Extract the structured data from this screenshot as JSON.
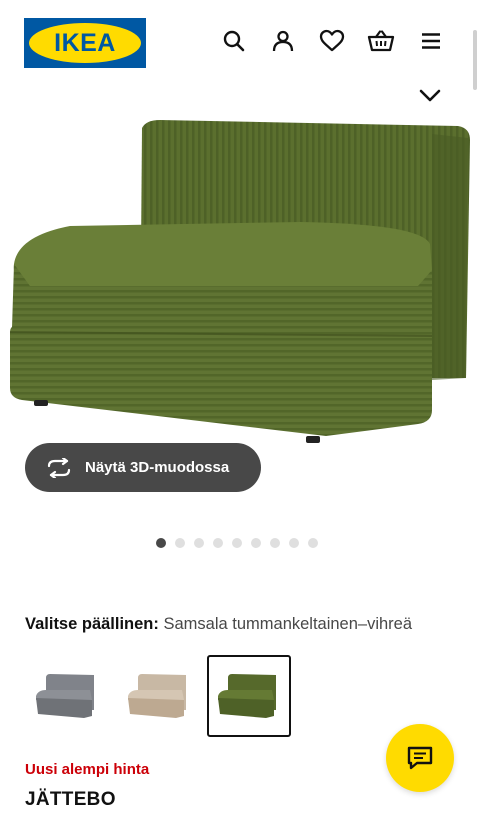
{
  "header": {
    "logo_text": "IKEA",
    "icons": [
      "search-icon",
      "user-icon",
      "heart-icon",
      "cart-icon",
      "menu-icon"
    ]
  },
  "gallery": {
    "button_3d_label": "Näytä 3D-muodossa",
    "dots_count": 9,
    "active_dot": 1
  },
  "cover": {
    "label": "Valitse päällinen:",
    "value": "Samsala tummankeltainen–vihreä",
    "swatches": [
      {
        "color": "grey",
        "hex": "#7a7c80",
        "selected": false
      },
      {
        "color": "beige",
        "hex": "#c9b9a6",
        "selected": false
      },
      {
        "color": "green",
        "hex": "#5b6f2e",
        "selected": true
      }
    ]
  },
  "product": {
    "price_tag": "Uusi alempi hinta",
    "name": "JÄTTEBO"
  },
  "colors": {
    "ikea_blue": "#0058a3",
    "ikea_yellow": "#ffdb00",
    "sofa_green": "#5b6f2e",
    "price_red": "#cc0008"
  }
}
